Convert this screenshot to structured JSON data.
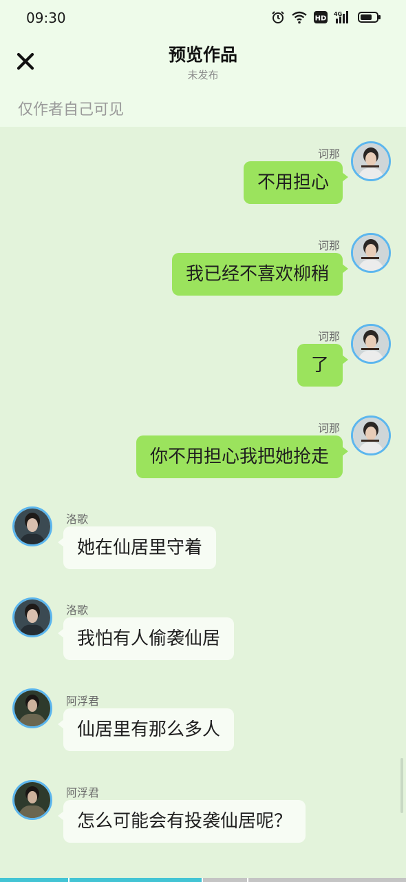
{
  "status_bar": {
    "time": "09:30",
    "icons": [
      "alarm-icon",
      "wifi-icon",
      "hd-icon",
      "signal-4g-icon",
      "battery-icon"
    ],
    "hd_label": "HD",
    "network_label": "4G"
  },
  "header": {
    "title": "预览作品",
    "subtitle": "未发布",
    "close_icon": "close-icon"
  },
  "visibility_note": "仅作者自己可见",
  "messages": [
    {
      "side": "right",
      "sender": "诃那",
      "text": "不用担心"
    },
    {
      "side": "right",
      "sender": "诃那",
      "text": "我已经不喜欢柳稍"
    },
    {
      "side": "right",
      "sender": "诃那",
      "text": "了"
    },
    {
      "side": "right",
      "sender": "诃那",
      "text": "你不用担心我把她抢走"
    },
    {
      "side": "left",
      "sender": "洛歌",
      "text": "她在仙居里守着"
    },
    {
      "side": "left",
      "sender": "洛歌",
      "text": "我怕有人偷袭仙居"
    },
    {
      "side": "left",
      "sender": "阿浮君",
      "text": "仙居里有那么多人"
    },
    {
      "side": "left",
      "sender": "阿浮君",
      "text": "怎么可能会有投袭仙居呢？"
    }
  ],
  "progress": {
    "fraction": 0.5,
    "segments": 4
  },
  "colors": {
    "chat_background": "#e3f3db",
    "header_background": "#eefbea",
    "own_bubble": "#9be35d",
    "other_bubble": "#f7fcf4",
    "avatar_border": "#5cb6ee",
    "progress_fill": "#43c4d4"
  }
}
